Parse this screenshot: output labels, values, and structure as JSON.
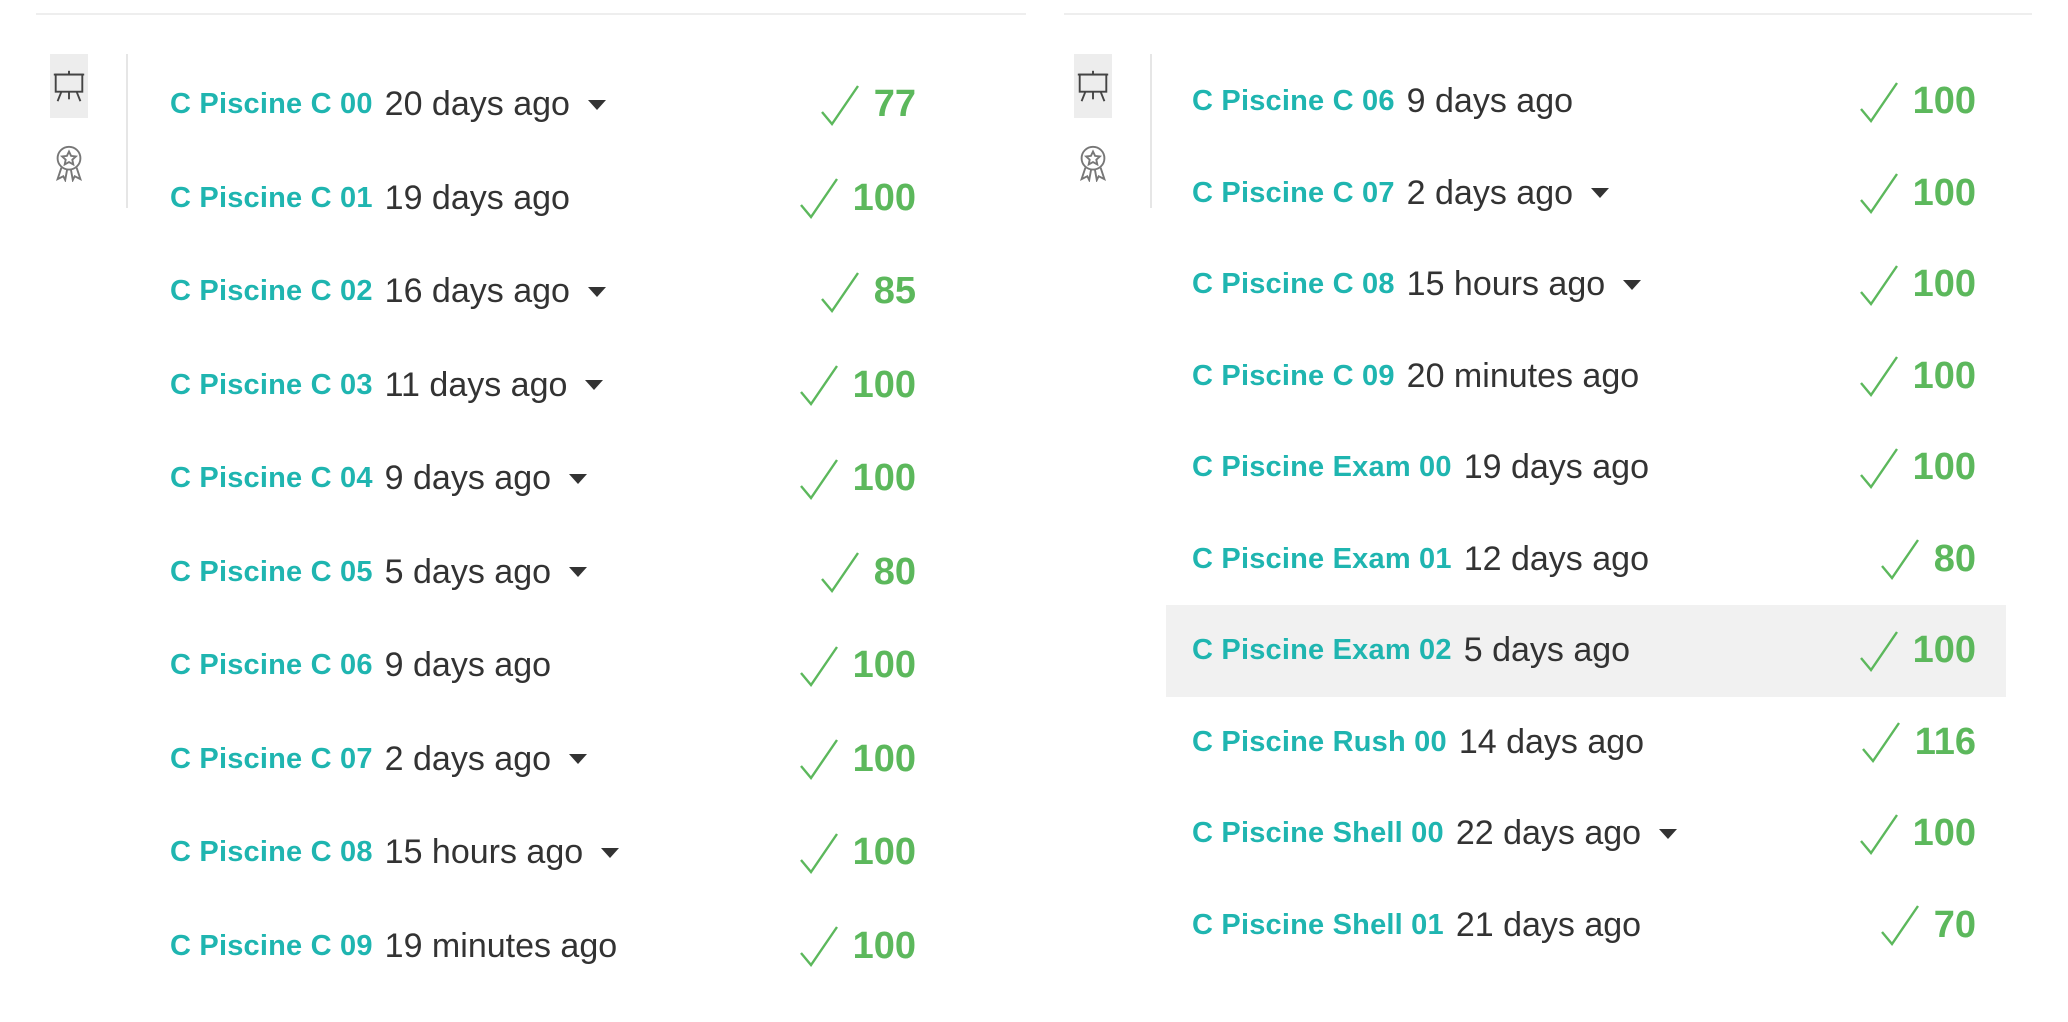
{
  "colors": {
    "project": "#1fb5b0",
    "score": "#5cb85c",
    "text": "#333333",
    "highlight": "#f1f1f1"
  },
  "icons": {
    "tab1": "presentation-board-icon",
    "tab2": "award-badge-icon",
    "check": "checkmark-icon",
    "caret": "caret-down-icon"
  },
  "left": {
    "projects": [
      {
        "name": "C Piscine C 00",
        "ago": "20 days ago",
        "score": "77"
      },
      {
        "name": "C Piscine C 01",
        "ago": "19 days ago",
        "score": "100"
      },
      {
        "name": "C Piscine C 02",
        "ago": "16 days ago",
        "score": "85"
      },
      {
        "name": "C Piscine C 03",
        "ago": "11 days ago",
        "score": "100"
      },
      {
        "name": "C Piscine C 04",
        "ago": "9 days ago",
        "score": "100"
      },
      {
        "name": "C Piscine C 05",
        "ago": "5 days ago",
        "score": "80"
      },
      {
        "name": "C Piscine C 06",
        "ago": "9 days ago",
        "score": "100"
      },
      {
        "name": "C Piscine C 07",
        "ago": "2 days ago",
        "score": "100"
      },
      {
        "name": "C Piscine C 08",
        "ago": "15 hours ago",
        "score": "100"
      },
      {
        "name": "C Piscine C 09",
        "ago": "19 minutes ago",
        "score": "100"
      }
    ]
  },
  "right": {
    "projects": [
      {
        "name": "C Piscine C 06",
        "ago": "9 days ago",
        "score": "100"
      },
      {
        "name": "C Piscine C 07",
        "ago": "2 days ago",
        "score": "100"
      },
      {
        "name": "C Piscine C 08",
        "ago": "15 hours ago",
        "score": "100"
      },
      {
        "name": "C Piscine C 09",
        "ago": "20 minutes ago",
        "score": "100"
      },
      {
        "name": "C Piscine Exam 00",
        "ago": "19 days ago",
        "score": "100"
      },
      {
        "name": "C Piscine Exam 01",
        "ago": "12 days ago",
        "score": "80"
      },
      {
        "name": "C Piscine Exam 02",
        "ago": "5 days ago",
        "score": "100"
      },
      {
        "name": "C Piscine Rush 00",
        "ago": "14 days ago",
        "score": "116"
      },
      {
        "name": "C Piscine Shell 00",
        "ago": "22 days ago",
        "score": "100"
      },
      {
        "name": "C Piscine Shell 01",
        "ago": "21 days ago",
        "score": "70"
      }
    ]
  }
}
